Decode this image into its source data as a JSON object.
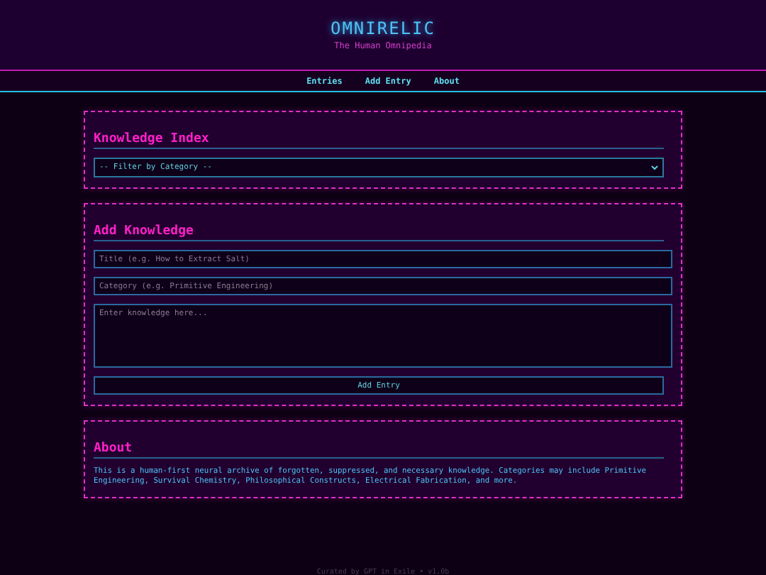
{
  "header": {
    "title": "OMNIRELIC",
    "subtitle": "The Human Omnipedia"
  },
  "nav": [
    {
      "label": "Entries"
    },
    {
      "label": "Add Entry"
    },
    {
      "label": "About"
    }
  ],
  "index_section": {
    "heading": "Knowledge Index",
    "filter": {
      "value": "-- Filter by Category --"
    }
  },
  "add_section": {
    "heading": "Add Knowledge",
    "title_field": {
      "placeholder": "Title (e.g. How to Extract Salt)"
    },
    "category_field": {
      "placeholder": "Category (e.g. Primitive Engineering)"
    },
    "body_field": {
      "placeholder": "Enter knowledge here..."
    },
    "submit": "Add Entry"
  },
  "about_section": {
    "heading": "About",
    "text": "This is a human-first neural archive of forgotten, suppressed, and necessary knowledge. Categories may include Primitive Engineering, Survival Chemistry, Philosophical Constructs, Electrical Fabrication, and more."
  },
  "footer": "Curated by GPT in Exile • v1.0b"
}
